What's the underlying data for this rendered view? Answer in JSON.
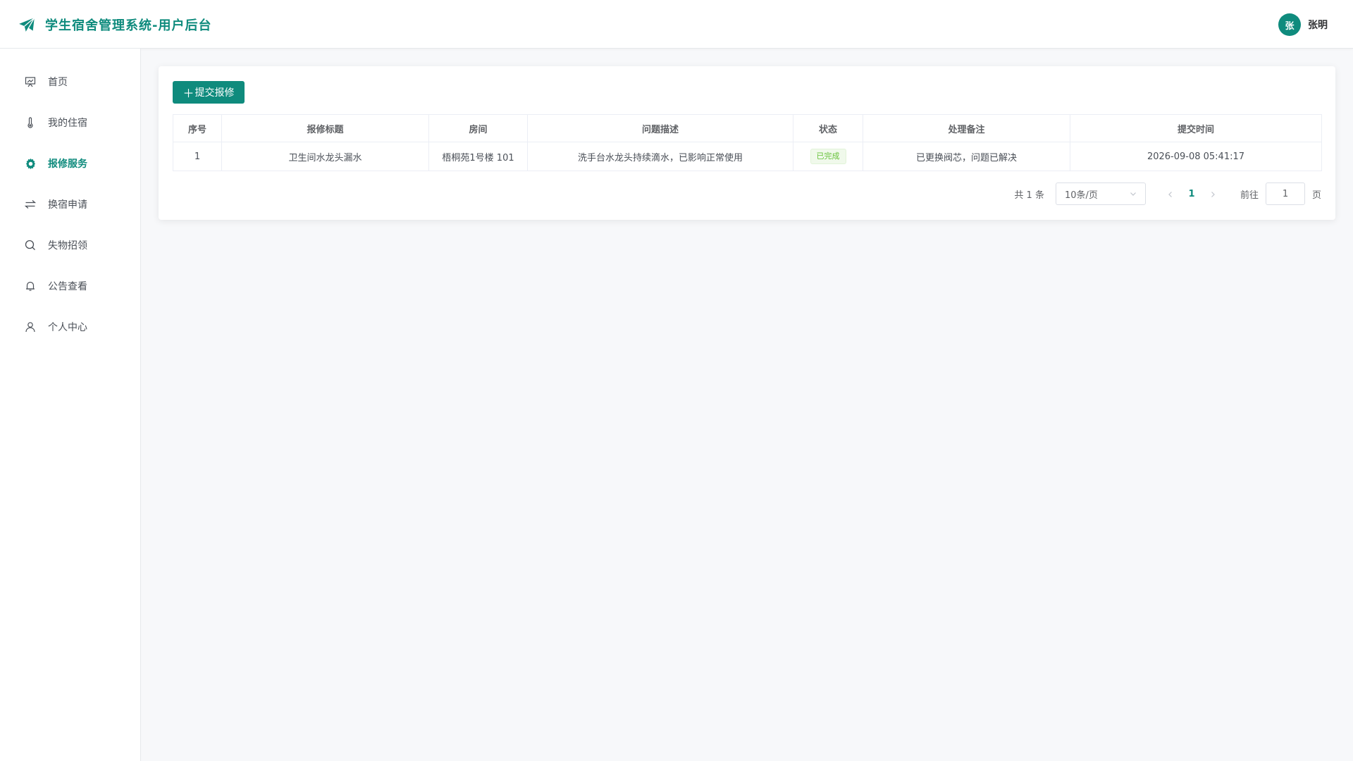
{
  "header": {
    "app_title": "学生宿舍管理系统-用户后台",
    "logo_icon": "paper-plane-icon",
    "user": {
      "avatar_text": "张",
      "name": "张明"
    }
  },
  "colors": {
    "primary": "#0f8b7d",
    "success": "#67c23a",
    "background": "#f7f8fa"
  },
  "sidebar": {
    "items": [
      {
        "label": "首页",
        "icon": "presentation-board-icon",
        "active": false
      },
      {
        "label": "我的住宿",
        "icon": "thermometer-icon",
        "active": false
      },
      {
        "label": "报修服务",
        "icon": "gear-icon",
        "active": true
      },
      {
        "label": "换宿申请",
        "icon": "swap-arrows-icon",
        "active": false
      },
      {
        "label": "失物招领",
        "icon": "search-icon",
        "active": false
      },
      {
        "label": "公告查看",
        "icon": "bell-icon",
        "active": false
      },
      {
        "label": "个人中心",
        "icon": "user-icon",
        "active": false
      }
    ]
  },
  "main": {
    "add_button_label": "提交报修",
    "table": {
      "columns": [
        "序号",
        "报修标题",
        "房间",
        "问题描述",
        "状态",
        "处理备注",
        "提交时间"
      ],
      "rows": [
        {
          "index": "1",
          "title": "卫生间水龙头漏水",
          "room": "梧桐苑1号楼 101",
          "description": "洗手台水龙头持续滴水，已影响正常使用",
          "status": "已完成",
          "note": "已更换阀芯，问题已解决",
          "submitted_at": "2026-09-08 05:41:17"
        }
      ]
    },
    "pagination": {
      "total_text": "共 1 条",
      "page_size": "10条/页",
      "current_page": "1",
      "goto_label": "前往",
      "goto_value": "1",
      "page_suffix": "页"
    }
  }
}
